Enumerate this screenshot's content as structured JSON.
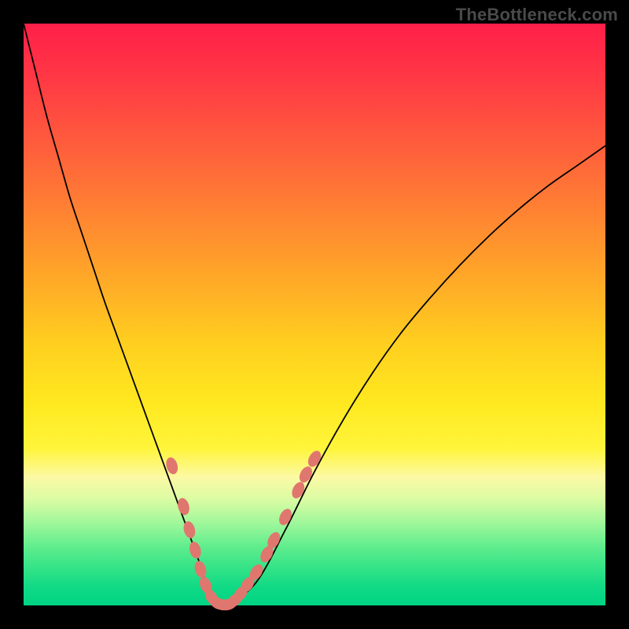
{
  "watermark": "TheBottleneck.com",
  "colors": {
    "frame": "#000000",
    "curve": "#000000",
    "marker": "#e0776e",
    "gradient_top": "#ff1f49",
    "gradient_bottom": "#00d484"
  },
  "chart_data": {
    "type": "line",
    "title": "",
    "xlabel": "",
    "ylabel": "",
    "xlim": [
      0,
      100
    ],
    "ylim": [
      0,
      100
    ],
    "grid": false,
    "legend": false,
    "x": [
      0,
      2,
      4,
      6,
      8,
      10,
      12,
      14,
      16,
      18,
      20,
      22,
      24,
      26,
      28,
      30,
      31,
      32,
      33,
      34,
      35,
      40,
      45,
      50,
      55,
      60,
      65,
      70,
      75,
      80,
      85,
      90,
      95,
      100
    ],
    "y": [
      100,
      92,
      84,
      77,
      70,
      64,
      58,
      52,
      46.5,
      41,
      35.5,
      30,
      24.5,
      19,
      13.5,
      8,
      5,
      3,
      1,
      0,
      0,
      4,
      13,
      23,
      32,
      40,
      47,
      53,
      58.5,
      63.5,
      68,
      72,
      75.5,
      79
    ],
    "series": [
      {
        "name": "bottleneck-curve",
        "note": "Single V-shaped bottleneck curve; minimum near x≈33–35 at y≈0. Left branch is steep and nearly linear from top-left; right branch rises with decreasing slope toward upper-right.",
        "x": [
          0,
          2,
          4,
          6,
          8,
          10,
          12,
          14,
          16,
          18,
          20,
          22,
          24,
          26,
          28,
          30,
          31,
          32,
          33,
          34,
          35,
          40,
          45,
          50,
          55,
          60,
          65,
          70,
          75,
          80,
          85,
          90,
          95,
          100
        ],
        "y": [
          100,
          92,
          84,
          77,
          70,
          64,
          58,
          52,
          46.5,
          41,
          35.5,
          30,
          24.5,
          19,
          13.5,
          8,
          5,
          3,
          1,
          0,
          0,
          4,
          13,
          23,
          32,
          40,
          47,
          53,
          58.5,
          63.5,
          68,
          72,
          75.5,
          79
        ]
      }
    ],
    "markers": {
      "note": "Pink oval markers clustered near the minimum on both branches",
      "points": [
        {
          "x": 25.5,
          "y": 24,
          "side": "left"
        },
        {
          "x": 27.5,
          "y": 17,
          "side": "left"
        },
        {
          "x": 28.5,
          "y": 13,
          "side": "left"
        },
        {
          "x": 29.5,
          "y": 9.5,
          "side": "left"
        },
        {
          "x": 30.4,
          "y": 6.2,
          "side": "left"
        },
        {
          "x": 31.3,
          "y": 3.5,
          "side": "left"
        },
        {
          "x": 32.3,
          "y": 1.4,
          "side": "bottom"
        },
        {
          "x": 33.3,
          "y": 0.4,
          "side": "bottom"
        },
        {
          "x": 34.3,
          "y": 0.1,
          "side": "bottom"
        },
        {
          "x": 35.3,
          "y": 0.2,
          "side": "bottom"
        },
        {
          "x": 36.3,
          "y": 0.9,
          "side": "bottom"
        },
        {
          "x": 37.3,
          "y": 2.0,
          "side": "right"
        },
        {
          "x": 38.5,
          "y": 3.6,
          "side": "right"
        },
        {
          "x": 40.0,
          "y": 5.7,
          "side": "right"
        },
        {
          "x": 41.8,
          "y": 8.8,
          "side": "right"
        },
        {
          "x": 43.0,
          "y": 11.2,
          "side": "right"
        },
        {
          "x": 45.0,
          "y": 15.2,
          "side": "right"
        },
        {
          "x": 47.2,
          "y": 19.8,
          "side": "right"
        },
        {
          "x": 48.5,
          "y": 22.5,
          "side": "right"
        },
        {
          "x": 50.0,
          "y": 25.2,
          "side": "right"
        }
      ]
    }
  }
}
